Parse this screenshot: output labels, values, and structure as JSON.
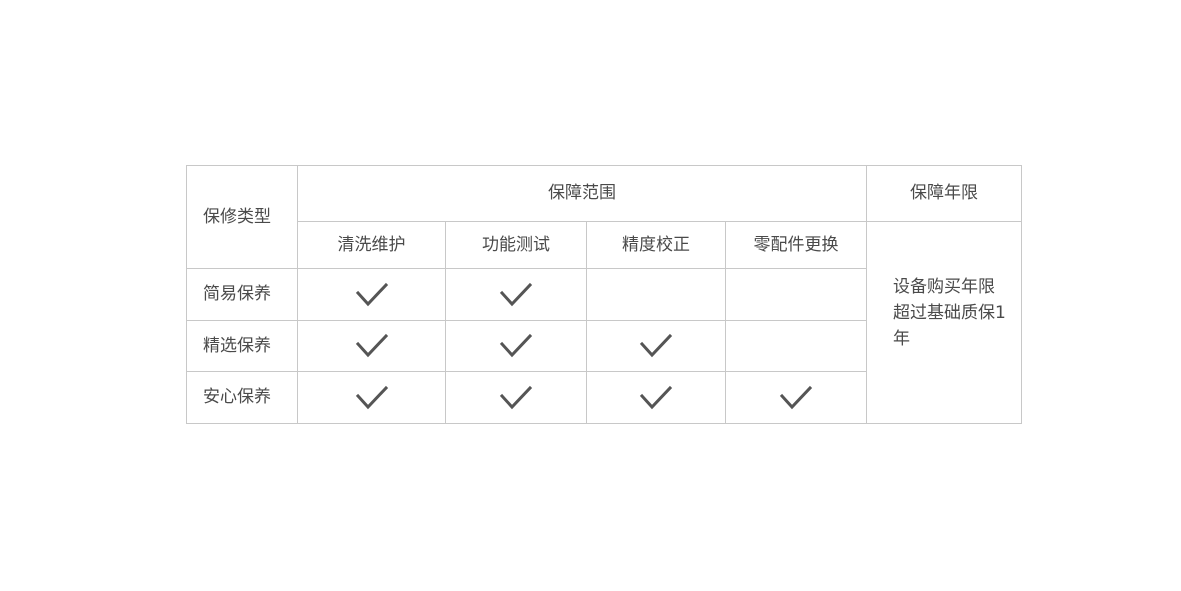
{
  "table": {
    "header": {
      "type_label": "保修类型",
      "scope_label": "保障范围",
      "period_label": "保障年限"
    },
    "columns": [
      "清洗维护",
      "功能测试",
      "精度校正",
      "零配件更换"
    ],
    "rows": [
      {
        "name": "简易保养",
        "checks": [
          true,
          true,
          false,
          false
        ]
      },
      {
        "name": "精选保养",
        "checks": [
          true,
          true,
          true,
          false
        ]
      },
      {
        "name": "安心保养",
        "checks": [
          true,
          true,
          true,
          true
        ]
      }
    ],
    "period_note": "设备购买年限超过基础质保1年",
    "check_icon": "checkmark-icon",
    "colors": {
      "border": "#c8c8c8",
      "text": "#4a4a4a",
      "check": "#555555"
    }
  }
}
